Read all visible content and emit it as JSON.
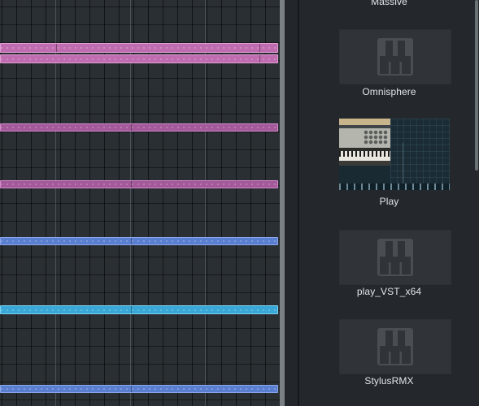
{
  "arrange": {
    "lanes": [
      {
        "name": "lane-1",
        "color": "pink",
        "clips": 2
      },
      {
        "name": "lane-2",
        "color": "pink-dark",
        "clips": 1
      },
      {
        "name": "lane-3",
        "color": "pink-dark",
        "clips": 1
      },
      {
        "name": "lane-4",
        "color": "blue",
        "clips": 1
      },
      {
        "name": "lane-5",
        "color": "cyan",
        "clips": 1
      },
      {
        "name": "lane-6",
        "color": "blue",
        "clips": 1
      }
    ],
    "colors": {
      "pink": "#c06cb0",
      "blue": "#5b7fd0",
      "cyan": "#3aa8d6",
      "grid": "#2a2f33"
    }
  },
  "browser": {
    "plugins": [
      {
        "label": "Massive",
        "icon": "piano-keys-icon"
      },
      {
        "label": "Omnisphere",
        "icon": "piano-keys-icon"
      },
      {
        "label": "Play",
        "icon": "play-thumbnail"
      },
      {
        "label": "play_VST_x64",
        "icon": "piano-keys-icon"
      },
      {
        "label": "StylusRMX",
        "icon": "piano-keys-icon"
      }
    ]
  }
}
